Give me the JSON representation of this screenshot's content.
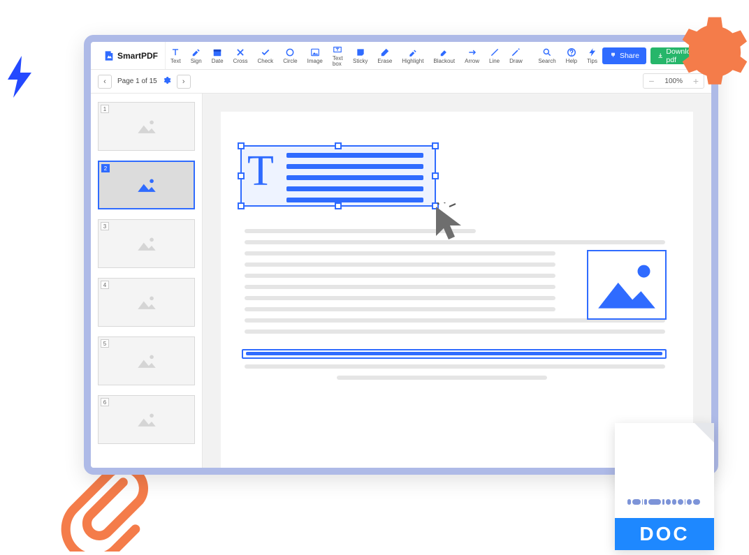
{
  "brand": {
    "name": "SmartPDF"
  },
  "toolbar": [
    {
      "label": "Text"
    },
    {
      "label": "Sign"
    },
    {
      "label": "Date"
    },
    {
      "label": "Cross"
    },
    {
      "label": "Check"
    },
    {
      "label": "Circle"
    },
    {
      "label": "Image"
    },
    {
      "label": "Text box"
    },
    {
      "label": "Sticky"
    },
    {
      "label": "Erase"
    },
    {
      "label": "Highlight"
    },
    {
      "label": "Blackout"
    },
    {
      "label": "Arrow"
    },
    {
      "label": "Line"
    },
    {
      "label": "Draw"
    },
    {
      "label": "Search"
    },
    {
      "label": "Help"
    },
    {
      "label": "Tips"
    }
  ],
  "actions": {
    "share": "Share",
    "download": "Download pdf"
  },
  "pager": {
    "label": "Page 1 of 15",
    "prev": "‹",
    "next": "›"
  },
  "zoom": {
    "level": "100%"
  },
  "thumbs": [
    {
      "n": "1"
    },
    {
      "n": "2",
      "active": true
    },
    {
      "n": "3"
    },
    {
      "n": "4"
    },
    {
      "n": "5"
    },
    {
      "n": "6"
    }
  ],
  "doc_icon": {
    "label": "DOC"
  }
}
